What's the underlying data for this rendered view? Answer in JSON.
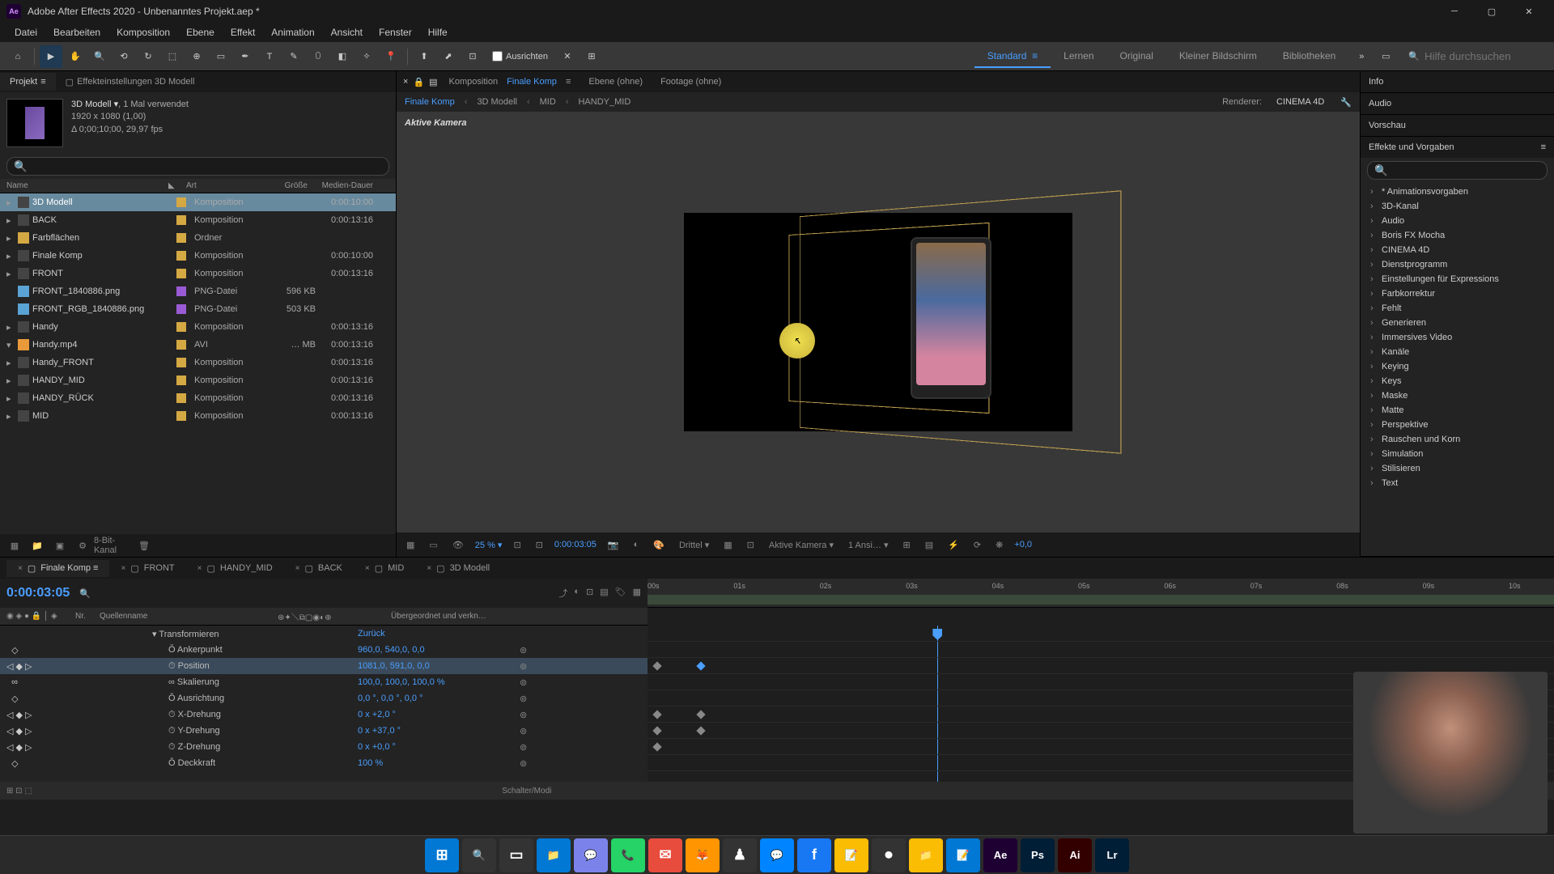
{
  "app": {
    "title": "Adobe After Effects 2020 - Unbenanntes Projekt.aep *",
    "logo": "Ae"
  },
  "menubar": [
    "Datei",
    "Bearbeiten",
    "Komposition",
    "Ebene",
    "Effekt",
    "Animation",
    "Ansicht",
    "Fenster",
    "Hilfe"
  ],
  "toolbar": {
    "ausrichten": "Ausrichten"
  },
  "workspaces": {
    "items": [
      "Standard",
      "Lernen",
      "Original",
      "Kleiner Bildschirm",
      "Bibliotheken"
    ],
    "active": 0,
    "search_placeholder": "Hilfe durchsuchen"
  },
  "project": {
    "tab_project": "Projekt",
    "tab_effect": "Effekteinstellungen 3D Modell",
    "comp_name": "3D Modell ▾",
    "comp_usage": ", 1 Mal verwendet",
    "comp_size": "1920 x 1080 (1,00)",
    "comp_dur": "Δ 0;00;10;00, 29,97 fps",
    "cols": {
      "name": "Name",
      "art": "Art",
      "size": "Größe",
      "dur": "Medien-Dauer"
    },
    "items": [
      {
        "name": "3D Modell",
        "icon": "comp",
        "art": "Komposition",
        "size": "",
        "dur": "0:00:10:00",
        "selected": true,
        "expand": "▸"
      },
      {
        "name": "BACK",
        "icon": "comp",
        "art": "Komposition",
        "size": "",
        "dur": "0:00:13:16",
        "expand": "▸"
      },
      {
        "name": "Farbflächen",
        "icon": "folder",
        "art": "Ordner",
        "size": "",
        "dur": "",
        "expand": "▸"
      },
      {
        "name": "Finale Komp",
        "icon": "comp",
        "art": "Komposition",
        "size": "",
        "dur": "0:00:10:00",
        "expand": "▸"
      },
      {
        "name": "FRONT",
        "icon": "comp",
        "art": "Komposition",
        "size": "",
        "dur": "0:00:13:16",
        "expand": "▸"
      },
      {
        "name": "FRONT_1840886.png",
        "icon": "img",
        "art": "PNG-Datei",
        "size": "596 KB",
        "dur": "",
        "expand": ""
      },
      {
        "name": "FRONT_RGB_1840886.png",
        "icon": "img",
        "art": "PNG-Datei",
        "size": "503 KB",
        "dur": "",
        "expand": ""
      },
      {
        "name": "Handy",
        "icon": "comp",
        "art": "Komposition",
        "size": "",
        "dur": "0:00:13:16",
        "expand": "▸"
      },
      {
        "name": "Handy.mp4",
        "icon": "vid",
        "art": "AVI",
        "size": "… MB",
        "dur": "0:00:13:16",
        "expand": "▾"
      },
      {
        "name": "Handy_FRONT",
        "icon": "comp",
        "art": "Komposition",
        "size": "",
        "dur": "0:00:13:16",
        "expand": "▸"
      },
      {
        "name": "HANDY_MID",
        "icon": "comp",
        "art": "Komposition",
        "size": "",
        "dur": "0:00:13:16",
        "expand": "▸"
      },
      {
        "name": "HANDY_RÜCK",
        "icon": "comp",
        "art": "Komposition",
        "size": "",
        "dur": "0:00:13:16",
        "expand": "▸"
      },
      {
        "name": "MID",
        "icon": "comp",
        "art": "Komposition",
        "size": "",
        "dur": "0:00:13:16",
        "expand": "▸"
      }
    ],
    "footer_depth": "8-Bit-Kanal"
  },
  "composition": {
    "tab_komp": "Komposition",
    "tab_komp_name": "Finale Komp",
    "tab_layer": "Ebene (ohne)",
    "tab_footage": "Footage (ohne)",
    "breadcrumb": [
      "Finale Komp",
      "3D Modell",
      "MID",
      "HANDY_MID"
    ],
    "renderer_label": "Renderer:",
    "renderer_value": "CINEMA 4D",
    "camera_label": "Aktive Kamera",
    "footer": {
      "zoom": "25 %",
      "time": "0:00:03:05",
      "quality": "Drittel",
      "view": "Aktive Kamera",
      "views_n": "1 Ansi…",
      "exposure": "+0,0"
    }
  },
  "right_panels": {
    "info": "Info",
    "audio": "Audio",
    "vorschau": "Vorschau",
    "effekte": "Effekte und Vorgaben",
    "effects_list": [
      "* Animationsvorgaben",
      "3D-Kanal",
      "Audio",
      "Boris FX Mocha",
      "CINEMA 4D",
      "Dienstprogramm",
      "Einstellungen für Expressions",
      "Farbkorrektur",
      "Fehlt",
      "Generieren",
      "Immersives Video",
      "Kanäle",
      "Keying",
      "Keys",
      "Maske",
      "Matte",
      "Perspektive",
      "Rauschen und Korn",
      "Simulation",
      "Stilisieren",
      "Text"
    ]
  },
  "timeline": {
    "tabs": [
      "Finale Komp",
      "FRONT",
      "HANDY_MID",
      "BACK",
      "MID",
      "3D Modell"
    ],
    "active_tab": 0,
    "time": "0:00:03:05",
    "cols": {
      "nr": "Nr.",
      "name": "Quellenname",
      "parent": "Übergeordnet und verkn…"
    },
    "layers": [
      {
        "label": "Transformieren",
        "val": "Zurück",
        "indent": 1,
        "kf": ""
      },
      {
        "label": "Ankerpunkt",
        "val": "960,0, 540,0, 0,0",
        "indent": 2,
        "kf": "◇",
        "parent_ctrl": true
      },
      {
        "label": "Position",
        "val": "1081,0, 591,0, 0,0",
        "indent": 2,
        "kf": "◆",
        "selected": true,
        "parent_ctrl": true,
        "has_kf": [
          8,
          62
        ]
      },
      {
        "label": "Skalierung",
        "val": "100,0, 100,0, 100,0 %",
        "indent": 2,
        "kf": "∞",
        "parent_ctrl": true
      },
      {
        "label": "Ausrichtung",
        "val": "0,0 °, 0,0 °, 0,0 °",
        "indent": 2,
        "kf": "◇",
        "parent_ctrl": true
      },
      {
        "label": "X-Drehung",
        "val": "0 x +2,0 °",
        "indent": 2,
        "kf": "◆",
        "parent_ctrl": true,
        "has_kf": [
          8,
          62
        ]
      },
      {
        "label": "Y-Drehung",
        "val": "0 x +37,0 °",
        "indent": 2,
        "kf": "◆",
        "parent_ctrl": true,
        "has_kf": [
          8,
          62
        ]
      },
      {
        "label": "Z-Drehung",
        "val": "0 x +0,0 °",
        "indent": 2,
        "kf": "◆",
        "parent_ctrl": true,
        "has_kf": [
          8
        ]
      },
      {
        "label": "Deckkraft",
        "val": "100 %",
        "indent": 2,
        "kf": "◇",
        "parent_ctrl": true
      }
    ],
    "ruler": [
      "00s",
      "01s",
      "02s",
      "03s",
      "04s",
      "05s",
      "06s",
      "07s",
      "08s",
      "09s",
      "10s"
    ],
    "playhead_pct": 32,
    "footer_mode": "Schalter/Modi"
  },
  "taskbar_icons": [
    "⊞",
    "🔍",
    "▭",
    "📁",
    "💬",
    "📞",
    "✉",
    "🦊",
    "♟",
    "💬",
    "f",
    "📝",
    "⏺",
    "📁",
    "📝",
    "Ae",
    "Ps",
    "Ai",
    "Lr"
  ]
}
